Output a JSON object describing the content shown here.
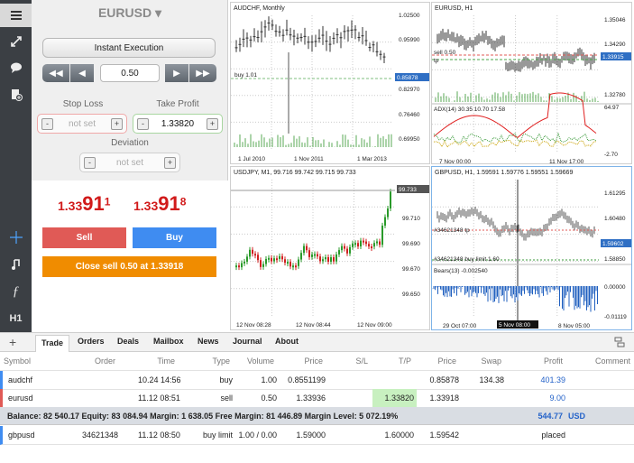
{
  "sidebar": {
    "timeframe": "H1"
  },
  "order_panel": {
    "symbol": "EURUSD ▾",
    "execution": "Instant Execution",
    "volume": "0.50",
    "stop_loss": {
      "label": "Stop Loss",
      "value": "not set"
    },
    "take_profit": {
      "label": "Take Profit",
      "value": "1.33820"
    },
    "deviation": {
      "label": "Deviation",
      "value": "not set"
    },
    "bid": {
      "prefix": "1.33",
      "big": "91",
      "sup": "1"
    },
    "ask": {
      "prefix": "1.33",
      "big": "91",
      "sup": "8"
    },
    "sell_label": "Sell",
    "buy_label": "Buy",
    "close_label": "Close sell 0.50 at 1.33918",
    "colors": {
      "sell": "#e05a56",
      "buy": "#3f8cf1",
      "close": "#f08c00",
      "price": "#d11a1a"
    }
  },
  "charts": {
    "audchf": {
      "title": "AUDCHF, Monthly",
      "prices": [
        "1.02500",
        "0.95990",
        "0.85878",
        "0.82970",
        "0.76460",
        "0.69950"
      ],
      "dates": [
        "1 Jul 2010",
        "1 Nov 2011",
        "1 Mar 2013"
      ],
      "line_label": "buy 1.01"
    },
    "eurusd": {
      "title": "EURUSD, H1",
      "prices": [
        "1.35046",
        "1.34290",
        "1.33915",
        "1.32780"
      ],
      "dates": [
        "7 Nov 00:00",
        "11 Nov 17:00"
      ],
      "sell_label": "sell 0.50",
      "tp_label": "tp",
      "adx": "ADX(14) 30.35 10.70 17.58",
      "adx_levels": [
        "64.97",
        "-2.70"
      ]
    },
    "usdjpy": {
      "title": "USDJPY, M1, 99.716 99.742 99.715 99.733",
      "prices": [
        "99.733",
        "99.710",
        "99.690",
        "99.670",
        "99.650"
      ],
      "dates": [
        "12 Nov 08:28",
        "12 Nov 08:44",
        "12 Nov 09:00"
      ]
    },
    "gbpusd": {
      "title": "GBPUSD, H1, 1.59591 1.59776 1.59551 1.59669",
      "prices": [
        "1.61295",
        "1.60480",
        "1.59602",
        "1.58850"
      ],
      "dates": [
        "29 Oct 07:00",
        "5 Nov 08:00",
        "8 Nov 05:00"
      ],
      "tp_label": "#34621348 tp",
      "buy_limit_label": "#34621348 buy limit 1.60",
      "bears": "Bears(13) -0.002540",
      "bears_levels": [
        "0.00000",
        "-0.01119"
      ]
    }
  },
  "tabs": [
    "Trade",
    "Orders",
    "Deals",
    "Mailbox",
    "News",
    "Journal",
    "About"
  ],
  "table": {
    "headers": [
      "Symbol",
      "Order",
      "Time",
      "Type",
      "Volume",
      "Price",
      "S/L",
      "T/P",
      "Price",
      "Swap",
      "Profit",
      "Comment"
    ],
    "rows": [
      [
        "audchf",
        "",
        "10.24 14:56",
        "buy",
        "1.00",
        "0.8551199",
        "",
        "",
        "0.85878",
        "134.38",
        "401.39",
        ""
      ],
      [
        "eurusd",
        "",
        "11.12 08:51",
        "sell",
        "0.50",
        "1.33936",
        "",
        "1.33820",
        "1.33918",
        "",
        "9.00",
        ""
      ]
    ],
    "balance": "Balance: 82 540.17 Equity: 83 084.94 Margin: 1 638.05 Free Margin: 81 446.89 Margin Level: 5 072.19%",
    "balance_profit": "544.77",
    "currency": "USD",
    "orders": [
      [
        "gbpusd",
        "34621348",
        "11.12 08:50",
        "buy limit",
        "1.00 / 0.00",
        "1.59000",
        "",
        "1.60000",
        "1.59542",
        "",
        "placed",
        ""
      ]
    ]
  }
}
